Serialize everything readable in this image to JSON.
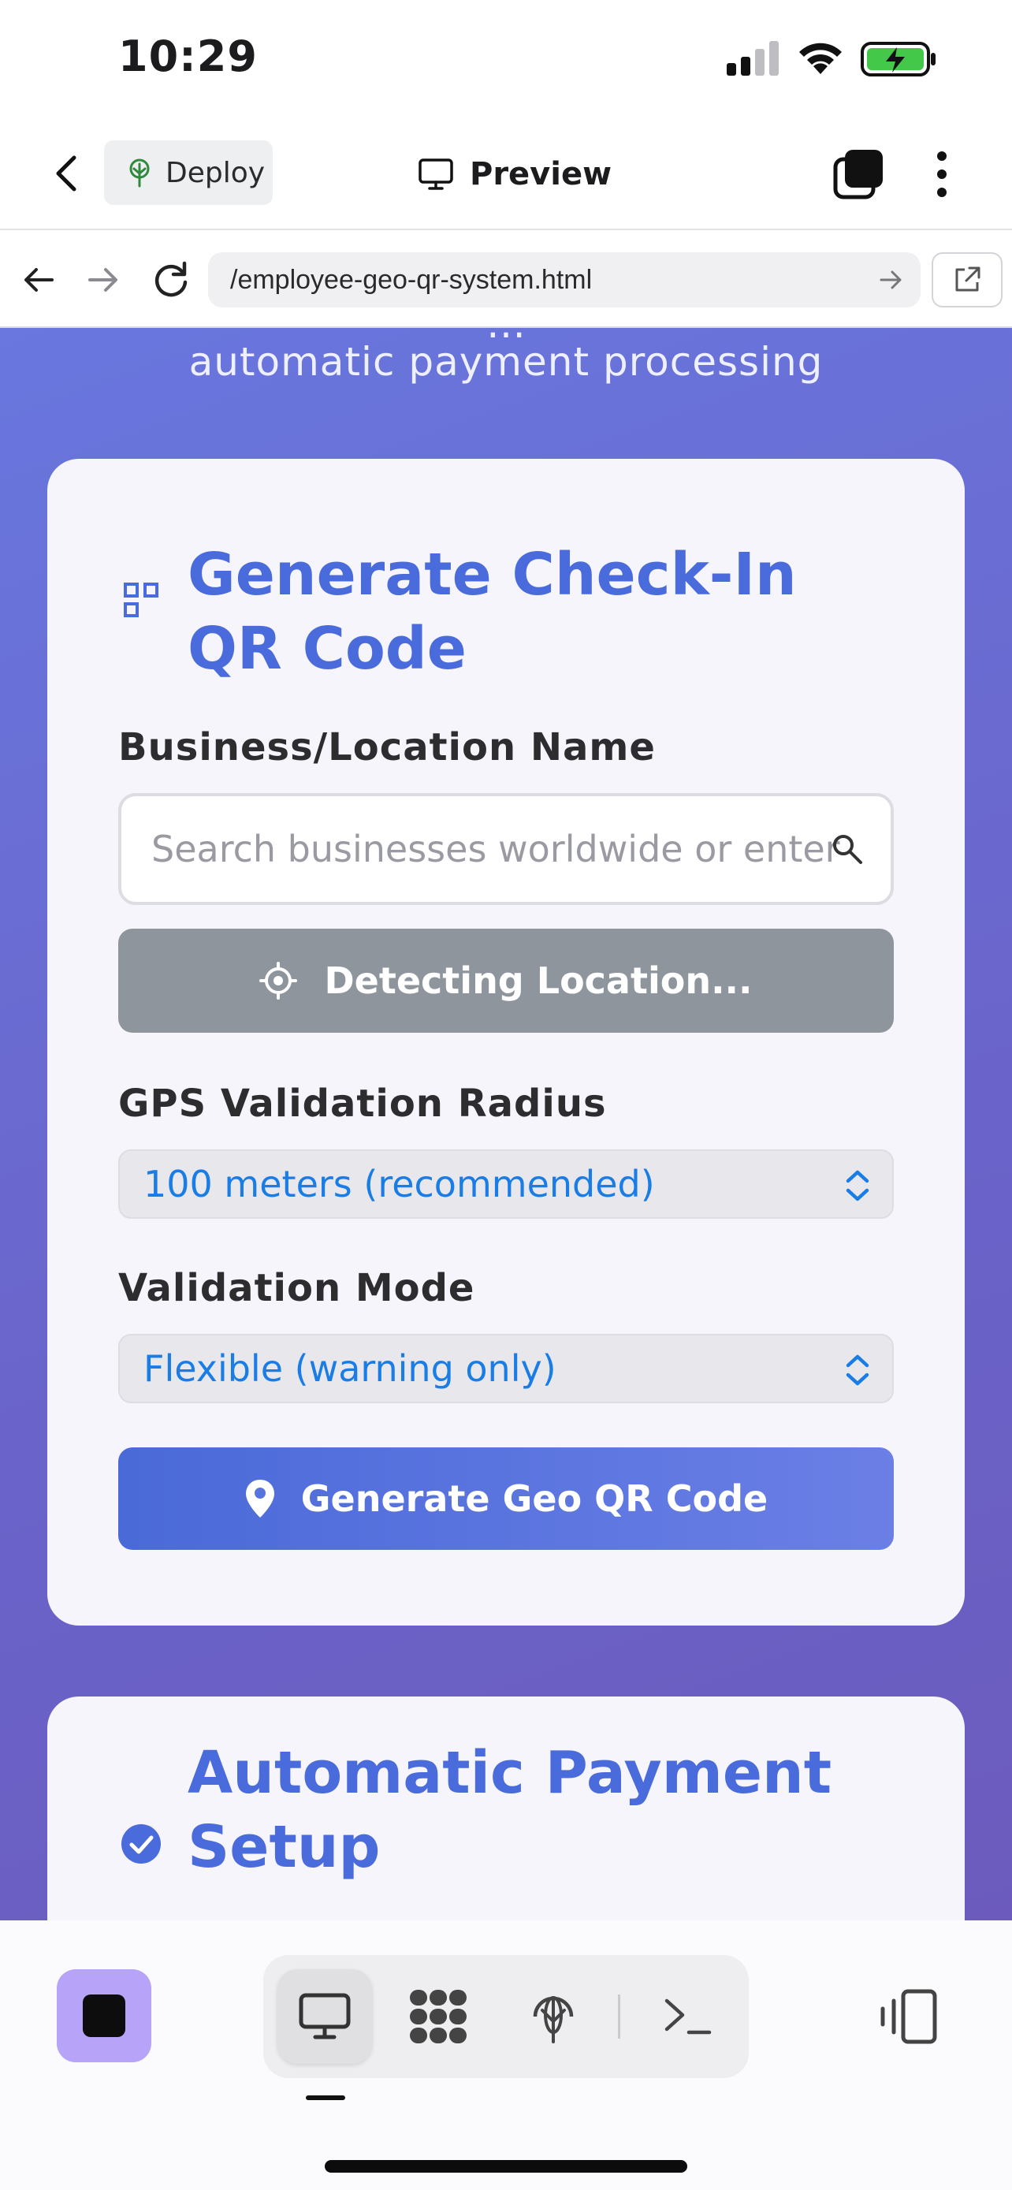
{
  "status_bar": {
    "time": "10:29"
  },
  "header": {
    "deploy_label": "Deploy",
    "preview_label": "Preview"
  },
  "browser": {
    "url": "/employee-geo-qr-system.html"
  },
  "page": {
    "hero_subtitle": "automatic payment processing",
    "qr_card": {
      "title_line1": "Generate Check-In",
      "title_line2": "QR Code",
      "business_label": "Business/Location Name",
      "business_placeholder": "Search businesses worldwide or enter any",
      "detect_button": "Detecting Location...",
      "radius_label": "GPS Validation Radius",
      "radius_value": "100 meters (recommended)",
      "mode_label": "Validation Mode",
      "mode_value": "Flexible (warning only)",
      "generate_button": "Generate Geo QR Code"
    },
    "payment_card": {
      "title_line1": "Automatic Payment",
      "title_line2": "Setup"
    }
  },
  "colors": {
    "accent": "#4a6bdb",
    "background_gradient_start": "#6977de",
    "background_gradient_end": "#6c5bbd",
    "detect_button": "#8f959d",
    "select_text": "#1a7de6",
    "stop_button": "#b7a3f7"
  },
  "icons": {
    "status": [
      "cellular-signal-icon",
      "wifi-icon",
      "battery-charging-icon"
    ],
    "header": [
      "chevron-left-icon",
      "deploy-tree-icon",
      "monitor-icon",
      "tabs-icon",
      "more-vertical-icon"
    ],
    "browser": [
      "arrow-left-icon",
      "arrow-right-icon",
      "reload-icon",
      "go-arrow-icon",
      "external-link-icon"
    ],
    "toolbar": [
      "stop-icon",
      "monitor-icon",
      "apps-grid-icon",
      "deploy-icon",
      "terminal-icon",
      "device-preview-icon"
    ]
  }
}
